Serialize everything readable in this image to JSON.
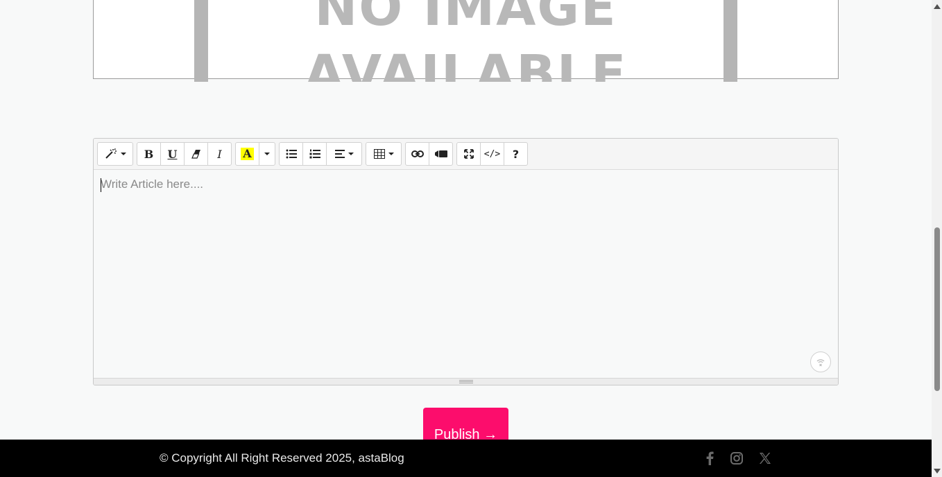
{
  "preview": {
    "line1": "NO IMAGE",
    "line2": "AVAILABLE"
  },
  "editor": {
    "placeholder": "Write Article here....",
    "toolbar": {
      "style_label": "",
      "highlight_label": "A",
      "help_label": "?",
      "code_label": "</>",
      "bold_label": "B",
      "underline_label": "U",
      "italic_label": "I"
    }
  },
  "publish": {
    "label": "Publish →"
  },
  "footer": {
    "copyright": "© Copyright All Right Reserved 2025, astaBlog",
    "social": [
      "facebook-icon",
      "instagram-icon",
      "x-twitter-icon"
    ]
  },
  "colors": {
    "accent": "#fc0d6c",
    "footer_bg": "#000000",
    "highlight": "#ffff00"
  }
}
